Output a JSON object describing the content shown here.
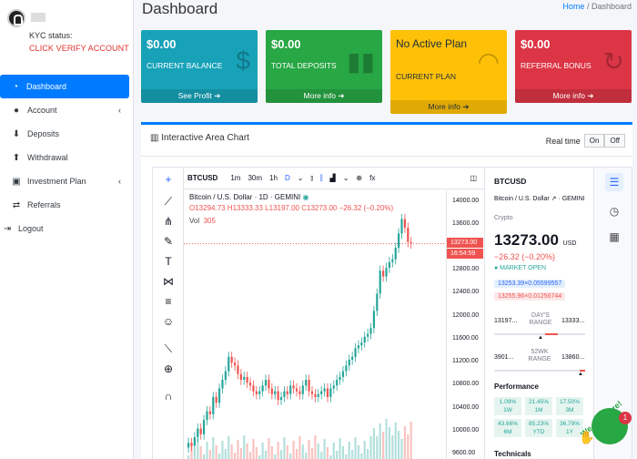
{
  "sidebar": {
    "kyc_label": "KYC status:",
    "kyc_action": "CLICK VERIFY ACCOUNT",
    "items": [
      {
        "label": "Dashboard",
        "icon": "dashboard-icon"
      },
      {
        "label": "Account",
        "icon": "user-icon"
      },
      {
        "label": "Deposits",
        "icon": "download-icon"
      },
      {
        "label": "Withdrawal",
        "icon": "upload-icon"
      },
      {
        "label": "Investment Plan",
        "icon": "briefcase-icon"
      },
      {
        "label": "Referrals",
        "icon": "exchange-icon"
      },
      {
        "label": "Logout",
        "icon": "logout-icon"
      }
    ]
  },
  "header": {
    "title": "Dashboard",
    "breadcrumb_home": "Home",
    "breadcrumb_sep": "/",
    "breadcrumb_current": "Dashboard"
  },
  "boxes": [
    {
      "value": "$0.00",
      "label": "CURRENT BALANCE",
      "footer": "See Profit ➔",
      "color": "#17a2b8"
    },
    {
      "value": "$0.00",
      "label": "TOTAL DEPOSITS",
      "footer": "More info ➔",
      "color": "#28a745"
    },
    {
      "value": "No Active Plan",
      "label": "CURRENT PLAN",
      "footer": "More info ➔",
      "color": "#ffc107"
    },
    {
      "value": "$0.00",
      "label": "REFERRAL BONUS",
      "footer": "More info ➔",
      "color": "#dc3545"
    }
  ],
  "card": {
    "title": "Interactive Area Chart",
    "realtime_label": "Real time",
    "on_label": "On",
    "off_label": "Off"
  },
  "tv": {
    "symbol": "BTCUSD",
    "intervals": [
      "1m",
      "30m",
      "1h",
      "D"
    ],
    "legend_title": "Bitcoin / U.S. Dollar · 1D · GEMINI",
    "legend_ohlc": "O13294.73 H13333.33 L13197.00 C13273.00 −26.32 (−0.20%)",
    "vol_label": "Vol",
    "vol_value": "305",
    "axis_ticks": [
      "14000.00",
      "13600.00",
      "12800.00",
      "12400.00",
      "12000.00",
      "11600.00",
      "11200.00",
      "10800.00",
      "10400.00",
      "10000.00",
      "9600.00"
    ],
    "price_tag": "13273.00",
    "time_tag": "16:54:59",
    "side": {
      "symbol": "BTCUSD",
      "desc": "Bitcoin / U.S. Dollar ↗ · GEMINI",
      "type": "Crypto",
      "price": "13273.00",
      "currency": "USD",
      "change": "−26.32 (−0.20%)",
      "market": "● MARKET OPEN",
      "bid": "13253.39×0.05599557",
      "ask": "13255.96×0.01256744",
      "day_low": "13197...",
      "day_high": "13333...",
      "day_label": "DAY'S RANGE",
      "wk_low": "3901...",
      "wk_high": "13860...",
      "wk_label": "52WK RANGE",
      "perf_title": "Performance",
      "perf": [
        {
          "v": "1.09%",
          "p": "1W"
        },
        {
          "v": "21.45%",
          "p": "1M"
        },
        {
          "v": "17.50%",
          "p": "3M"
        },
        {
          "v": "43.66%",
          "p": "6M"
        },
        {
          "v": "85.23%",
          "p": "YTD"
        },
        {
          "v": "36.79%",
          "p": "1Y"
        }
      ],
      "tech_title": "Technicals"
    }
  },
  "widget": {
    "text": "We Are Here!",
    "badge": "1"
  },
  "chart_data": {
    "type": "candlestick",
    "symbol": "BTCUSD",
    "ylim": [
      9600,
      14000
    ],
    "last_close": 13273.0,
    "closes": [
      9800,
      9750,
      9900,
      10050,
      9950,
      10200,
      10350,
      10300,
      10600,
      10500,
      10750,
      10900,
      11050,
      11300,
      11200,
      11150,
      11000,
      10900,
      10950,
      10850,
      10800,
      10700,
      10650,
      10700,
      10800,
      10900,
      10750,
      10650,
      10700,
      10550,
      10600,
      10700,
      10650,
      10800,
      10750,
      10700,
      10650,
      10800,
      10900,
      10700,
      10650,
      10600,
      10650,
      10700,
      10750,
      10600,
      10750,
      10800,
      10900,
      10950,
      11050,
      11150,
      11250,
      11300,
      11450,
      11500,
      11550,
      11650,
      11700,
      11800,
      12100,
      12400,
      12800,
      12700,
      12850,
      12950,
      13000,
      13200,
      13450,
      13700,
      13550,
      13299,
      13273
    ]
  }
}
